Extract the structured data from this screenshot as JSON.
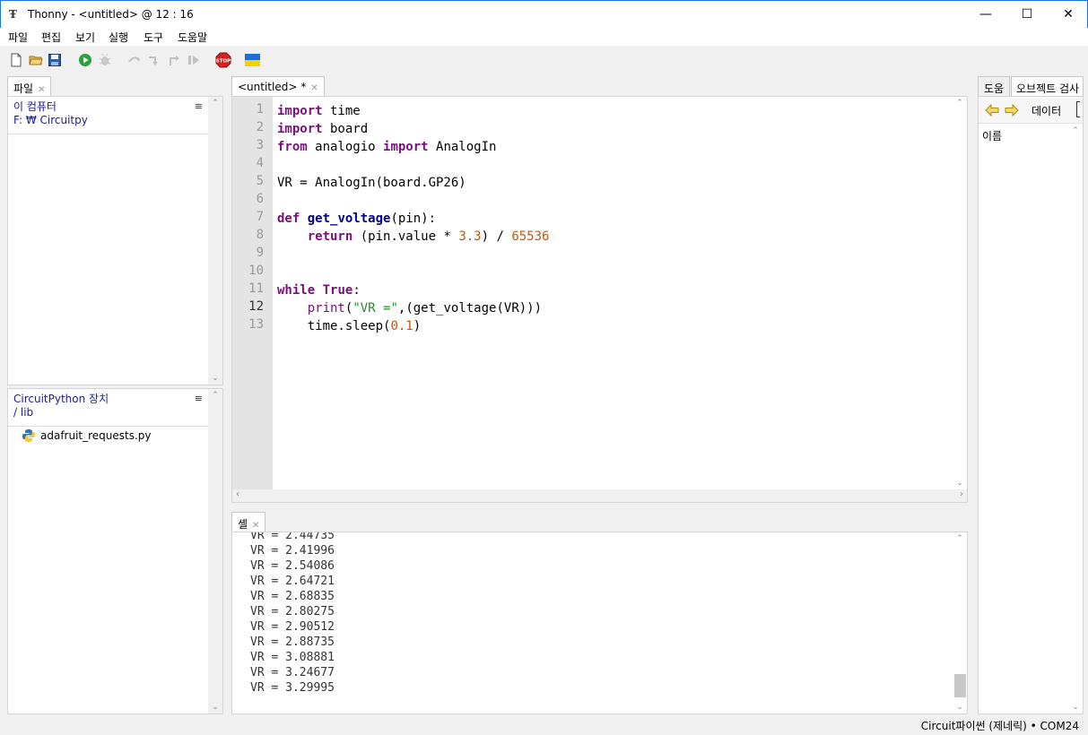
{
  "window": {
    "title": "Thonny  -  <untitled>  @  12 : 16",
    "minimize": "—",
    "maximize": "☐",
    "close": "✕"
  },
  "menu": [
    "파일",
    "편집",
    "보기",
    "실행",
    "도구",
    "도움말"
  ],
  "left_panel": {
    "tab_label": "파일",
    "computer_section": {
      "title": "이 컴퓨터",
      "path": "F: ₩ Circuitpy"
    },
    "device_section": {
      "title": "CircuitPython 장치",
      "path": "/ lib",
      "files": [
        "adafruit_requests.py"
      ]
    }
  },
  "editor": {
    "tab_label": "<untitled> *",
    "current_line": 12,
    "lines": [
      {
        "n": "1"
      },
      {
        "n": "2"
      },
      {
        "n": "3"
      },
      {
        "n": "4"
      },
      {
        "n": "5"
      },
      {
        "n": "6"
      },
      {
        "n": "7"
      },
      {
        "n": "8"
      },
      {
        "n": "9"
      },
      {
        "n": "10"
      },
      {
        "n": "11"
      },
      {
        "n": "12"
      },
      {
        "n": "13"
      }
    ],
    "code": [
      [
        {
          "t": "import",
          "c": "kw"
        },
        {
          "t": " time",
          "c": ""
        }
      ],
      [
        {
          "t": "import",
          "c": "kw"
        },
        {
          "t": " board",
          "c": ""
        }
      ],
      [
        {
          "t": "from",
          "c": "kw"
        },
        {
          "t": " analogio ",
          "c": ""
        },
        {
          "t": "import",
          "c": "kw"
        },
        {
          "t": " AnalogIn",
          "c": ""
        }
      ],
      [],
      [
        {
          "t": "VR = AnalogIn(board.GP26)",
          "c": ""
        }
      ],
      [],
      [
        {
          "t": "def",
          "c": "kw"
        },
        {
          "t": " ",
          "c": ""
        },
        {
          "t": "get_voltage",
          "c": "fn"
        },
        {
          "t": "(pin):",
          "c": ""
        }
      ],
      [
        {
          "t": "    ",
          "c": ""
        },
        {
          "t": "return",
          "c": "kw"
        },
        {
          "t": " (pin.value * ",
          "c": ""
        },
        {
          "t": "3.3",
          "c": "num"
        },
        {
          "t": ") / ",
          "c": ""
        },
        {
          "t": "65536",
          "c": "num"
        }
      ],
      [],
      [],
      [
        {
          "t": "while",
          "c": "kw"
        },
        {
          "t": " ",
          "c": ""
        },
        {
          "t": "True",
          "c": "kw"
        },
        {
          "t": ":",
          "c": ""
        }
      ],
      [
        {
          "t": "    ",
          "c": ""
        },
        {
          "t": "print",
          "c": "bi"
        },
        {
          "t": "(",
          "c": ""
        },
        {
          "t": "\"VR =\"",
          "c": "str"
        },
        {
          "t": ",(get_voltage(VR)))",
          "c": ""
        }
      ],
      [
        {
          "t": "    time.sleep(",
          "c": ""
        },
        {
          "t": "0.1",
          "c": "num"
        },
        {
          "t": ")",
          "c": ""
        }
      ]
    ]
  },
  "shell": {
    "tab_label": "셸",
    "lines": [
      "VR = 2.44735",
      "VR = 2.41996",
      "VR = 2.54086",
      "VR = 2.64721",
      "VR = 2.68835",
      "VR = 2.80275",
      "VR = 2.90512",
      "VR = 2.88735",
      "VR = 3.08881",
      "VR = 3.24677",
      "VR = 3.29995"
    ]
  },
  "right_panel": {
    "tabs": [
      "도움",
      "오브젝트 검사"
    ],
    "data_button": "데이터",
    "name_label": "이름"
  },
  "status": {
    "text": "Circuit파이썬 (제네릭)  •  COM24"
  },
  "colors": {
    "keyword": "#7a0f7a",
    "number": "#c5560c",
    "string": "#2a8c2a",
    "stop_red": "#d42020",
    "run_green": "#2e9e3e",
    "ukraine_blue": "#1f6fd1",
    "ukraine_yellow": "#f5d000"
  }
}
